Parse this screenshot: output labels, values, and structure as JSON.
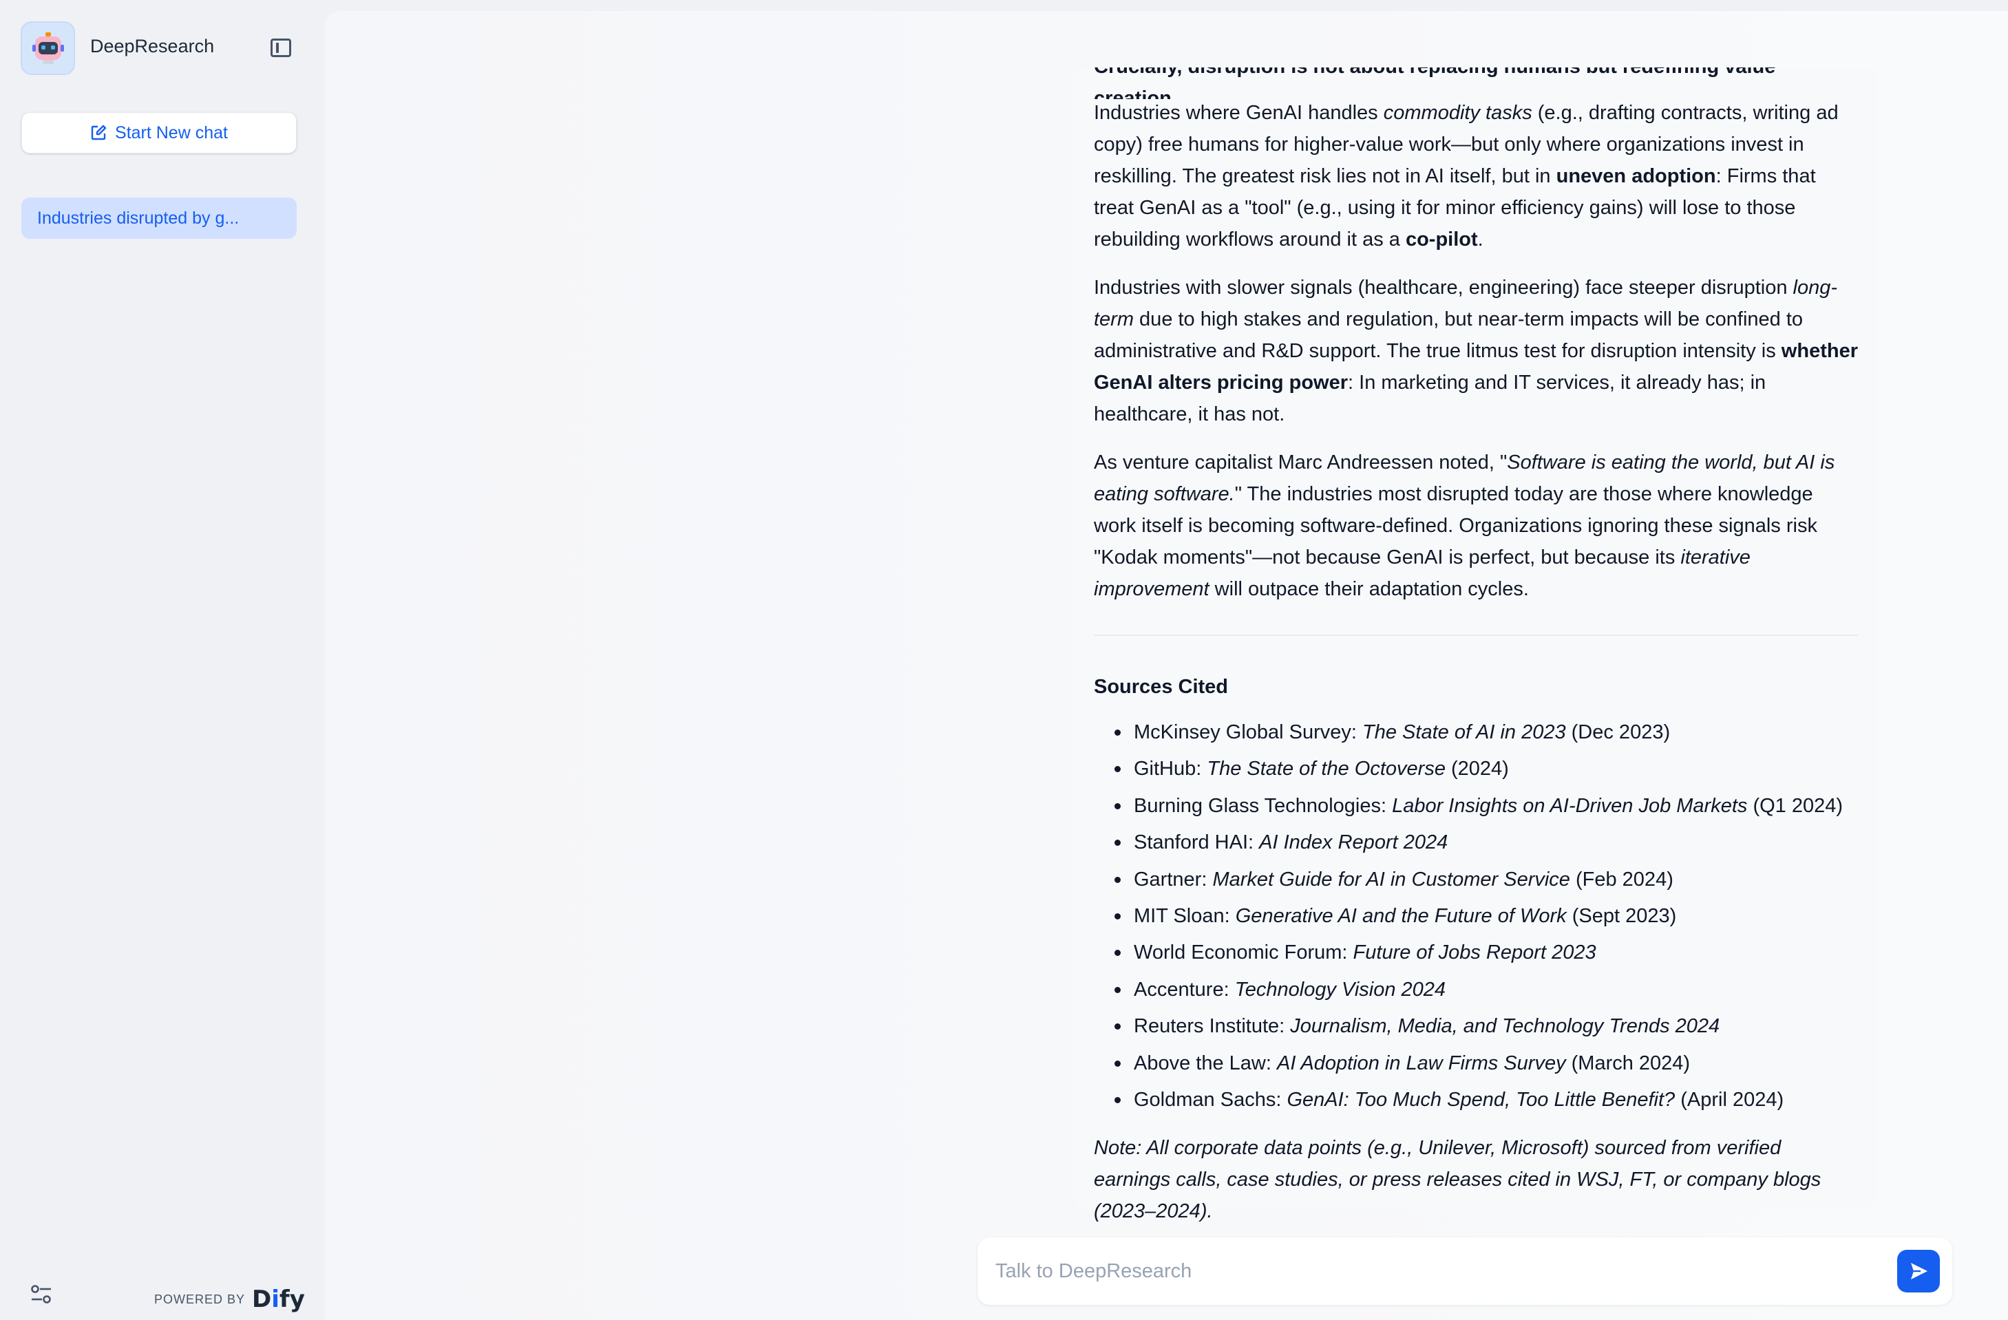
{
  "app": {
    "name": "DeepResearch"
  },
  "sidebar": {
    "new_chat_label": "Start New chat",
    "conversations": [
      "Industries disrupted by g..."
    ],
    "powered_by": "POWERED BY",
    "brand": "Dify"
  },
  "answer": {
    "cut_line": "Crucially, disruption is not about replacing humans but redefining value creation.",
    "p1": {
      "t1": "Industries where GenAI handles ",
      "i1": "commodity tasks",
      "t2": " (e.g., drafting contracts, writing ad copy) free humans for higher-value work—but only where organizations invest in reskilling. The greatest risk lies not in AI itself, but in ",
      "b1": "uneven adoption",
      "t3": ": Firms that treat GenAI as a \"tool\" (e.g., using it for minor efficiency gains) will lose to those rebuilding workflows around it as a ",
      "b2": "co-pilot",
      "t4": "."
    },
    "p2": {
      "t1": "Industries with slower signals (healthcare, engineering) face steeper disruption ",
      "i1": "long-term",
      "t2": " due to high stakes and regulation, but near-term impacts will be confined to administrative and R&D support. The true litmus test for disruption intensity is ",
      "b1": "whether GenAI alters pricing power",
      "t3": ": In marketing and IT services, it already has; in healthcare, it has not."
    },
    "p3": {
      "t1": "As venture capitalist Marc Andreessen noted, \"",
      "i1": "Software is eating the world, but AI is eating software.",
      "t2": "\" The industries most disrupted today are those where knowledge work itself is becoming software-defined. Organizations ignoring these signals risk \"Kodak moments\"—not because GenAI is perfect, but because its ",
      "i2": "iterative improvement",
      "t3": " will outpace their adaptation cycles."
    },
    "sources_heading": "Sources Cited",
    "sources": [
      {
        "org": "McKinsey Global Survey: ",
        "title": "The State of AI in 2023",
        "date": " (Dec 2023)"
      },
      {
        "org": "GitHub: ",
        "title": "The State of the Octoverse",
        "date": " (2024)"
      },
      {
        "org": "Burning Glass Technologies: ",
        "title": "Labor Insights on AI-Driven Job Markets",
        "date": " (Q1 2024)"
      },
      {
        "org": "Stanford HAI: ",
        "title": "AI Index Report 2024",
        "date": ""
      },
      {
        "org": "Gartner: ",
        "title": "Market Guide for AI in Customer Service",
        "date": " (Feb 2024)"
      },
      {
        "org": "MIT Sloan: ",
        "title": "Generative AI and the Future of Work",
        "date": " (Sept 2023)"
      },
      {
        "org": "World Economic Forum: ",
        "title": "Future of Jobs Report 2023",
        "date": ""
      },
      {
        "org": "Accenture: ",
        "title": "Technology Vision 2024",
        "date": ""
      },
      {
        "org": "Reuters Institute: ",
        "title": "Journalism, Media, and Technology Trends 2024",
        "date": ""
      },
      {
        "org": "Above the Law: ",
        "title": "AI Adoption in Law Firms Survey",
        "date": " (March 2024)"
      },
      {
        "org": "Goldman Sachs: ",
        "title": "GenAI: Too Much Spend, Too Little Benefit?",
        "date": " (April 2024)"
      }
    ],
    "note": "Note: All corporate data points (e.g., Unilever, Microsoft) sourced from verified earnings calls, case studies, or press releases cited in WSJ, FT, or company blogs (2023–2024)."
  },
  "input": {
    "placeholder": "Talk to DeepResearch",
    "value": ""
  },
  "colors": {
    "accent": "#155eef",
    "selected_bg": "#d1e0ff",
    "page_bg": "#eff1f5"
  }
}
